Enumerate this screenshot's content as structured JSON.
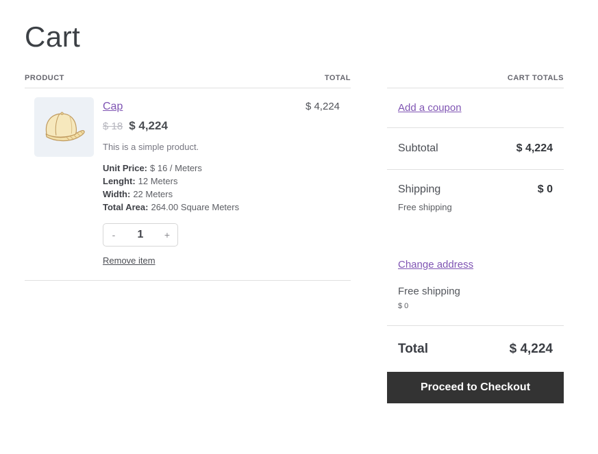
{
  "page": {
    "title": "Cart"
  },
  "colors": {
    "accent": "#7f54b3",
    "button-bg": "#333333",
    "button-text": "#ffffff",
    "heading": "#3c4045",
    "text": "#43454b",
    "muted": "#66666e",
    "border": "#e0e0e0",
    "thumb-bg": "#edf1f6",
    "old-price": "#b6b6be"
  },
  "cart_table": {
    "headers": {
      "product": "PRODUCT",
      "total": "TOTAL"
    },
    "item": {
      "name": "Cap",
      "image": "cap-illustration",
      "old_price": "$ 18",
      "price": "$ 4,224",
      "description": "This is a simple product.",
      "attributes": [
        {
          "label": "Unit Price:",
          "value": "$ 16 / Meters"
        },
        {
          "label": "Lenght:",
          "value": "12 Meters"
        },
        {
          "label": "Width:",
          "value": "22 Meters"
        },
        {
          "label": "Total Area:",
          "value": "264.00 Square Meters"
        }
      ],
      "quantity": "1",
      "decrease_label": "-",
      "increase_label": "+",
      "remove_label": "Remove item",
      "line_total": "$ 4,224"
    }
  },
  "cart_totals": {
    "header": "CART TOTALS",
    "coupon_link": "Add a coupon",
    "subtotal_label": "Subtotal",
    "subtotal_value": "$ 4,224",
    "shipping_label": "Shipping",
    "shipping_value": "$ 0",
    "shipping_note": "Free shipping",
    "change_address_link": "Change address",
    "shipping_method": "Free shipping",
    "shipping_method_price": "$ 0",
    "total_label": "Total",
    "total_value": "$ 4,224",
    "checkout_button": "Proceed to Checkout"
  }
}
